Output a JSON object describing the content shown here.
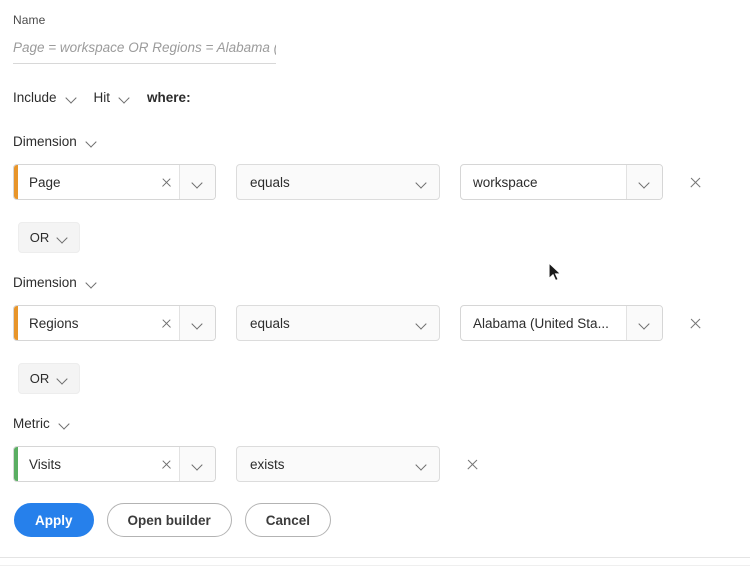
{
  "form": {
    "name_label": "Name",
    "name_value": "",
    "name_placeholder": "Page = workspace OR Regions = Alabama (..."
  },
  "scope": {
    "include_label": "Include",
    "container_label": "Hit",
    "where_label": "where:"
  },
  "rules": [
    {
      "group_type": "Dimension",
      "accent": "dimension",
      "accent_color": "#e8952a",
      "field": "Page",
      "operator": "equals",
      "value": "workspace",
      "has_value": true
    },
    {
      "group_type": "Dimension",
      "accent": "dimension",
      "accent_color": "#e8952a",
      "field": "Regions",
      "operator": "equals",
      "value": "Alabama (United Sta...",
      "has_value": true
    },
    {
      "group_type": "Metric",
      "accent": "metric",
      "accent_color": "#5aae62",
      "field": "Visits",
      "operator": "exists",
      "value": "",
      "has_value": false
    }
  ],
  "logic_operators": [
    {
      "label": "OR"
    },
    {
      "label": "OR"
    }
  ],
  "footer": {
    "apply_label": "Apply",
    "open_builder_label": "Open builder",
    "cancel_label": "Cancel",
    "primary_color": "#2680eb"
  }
}
